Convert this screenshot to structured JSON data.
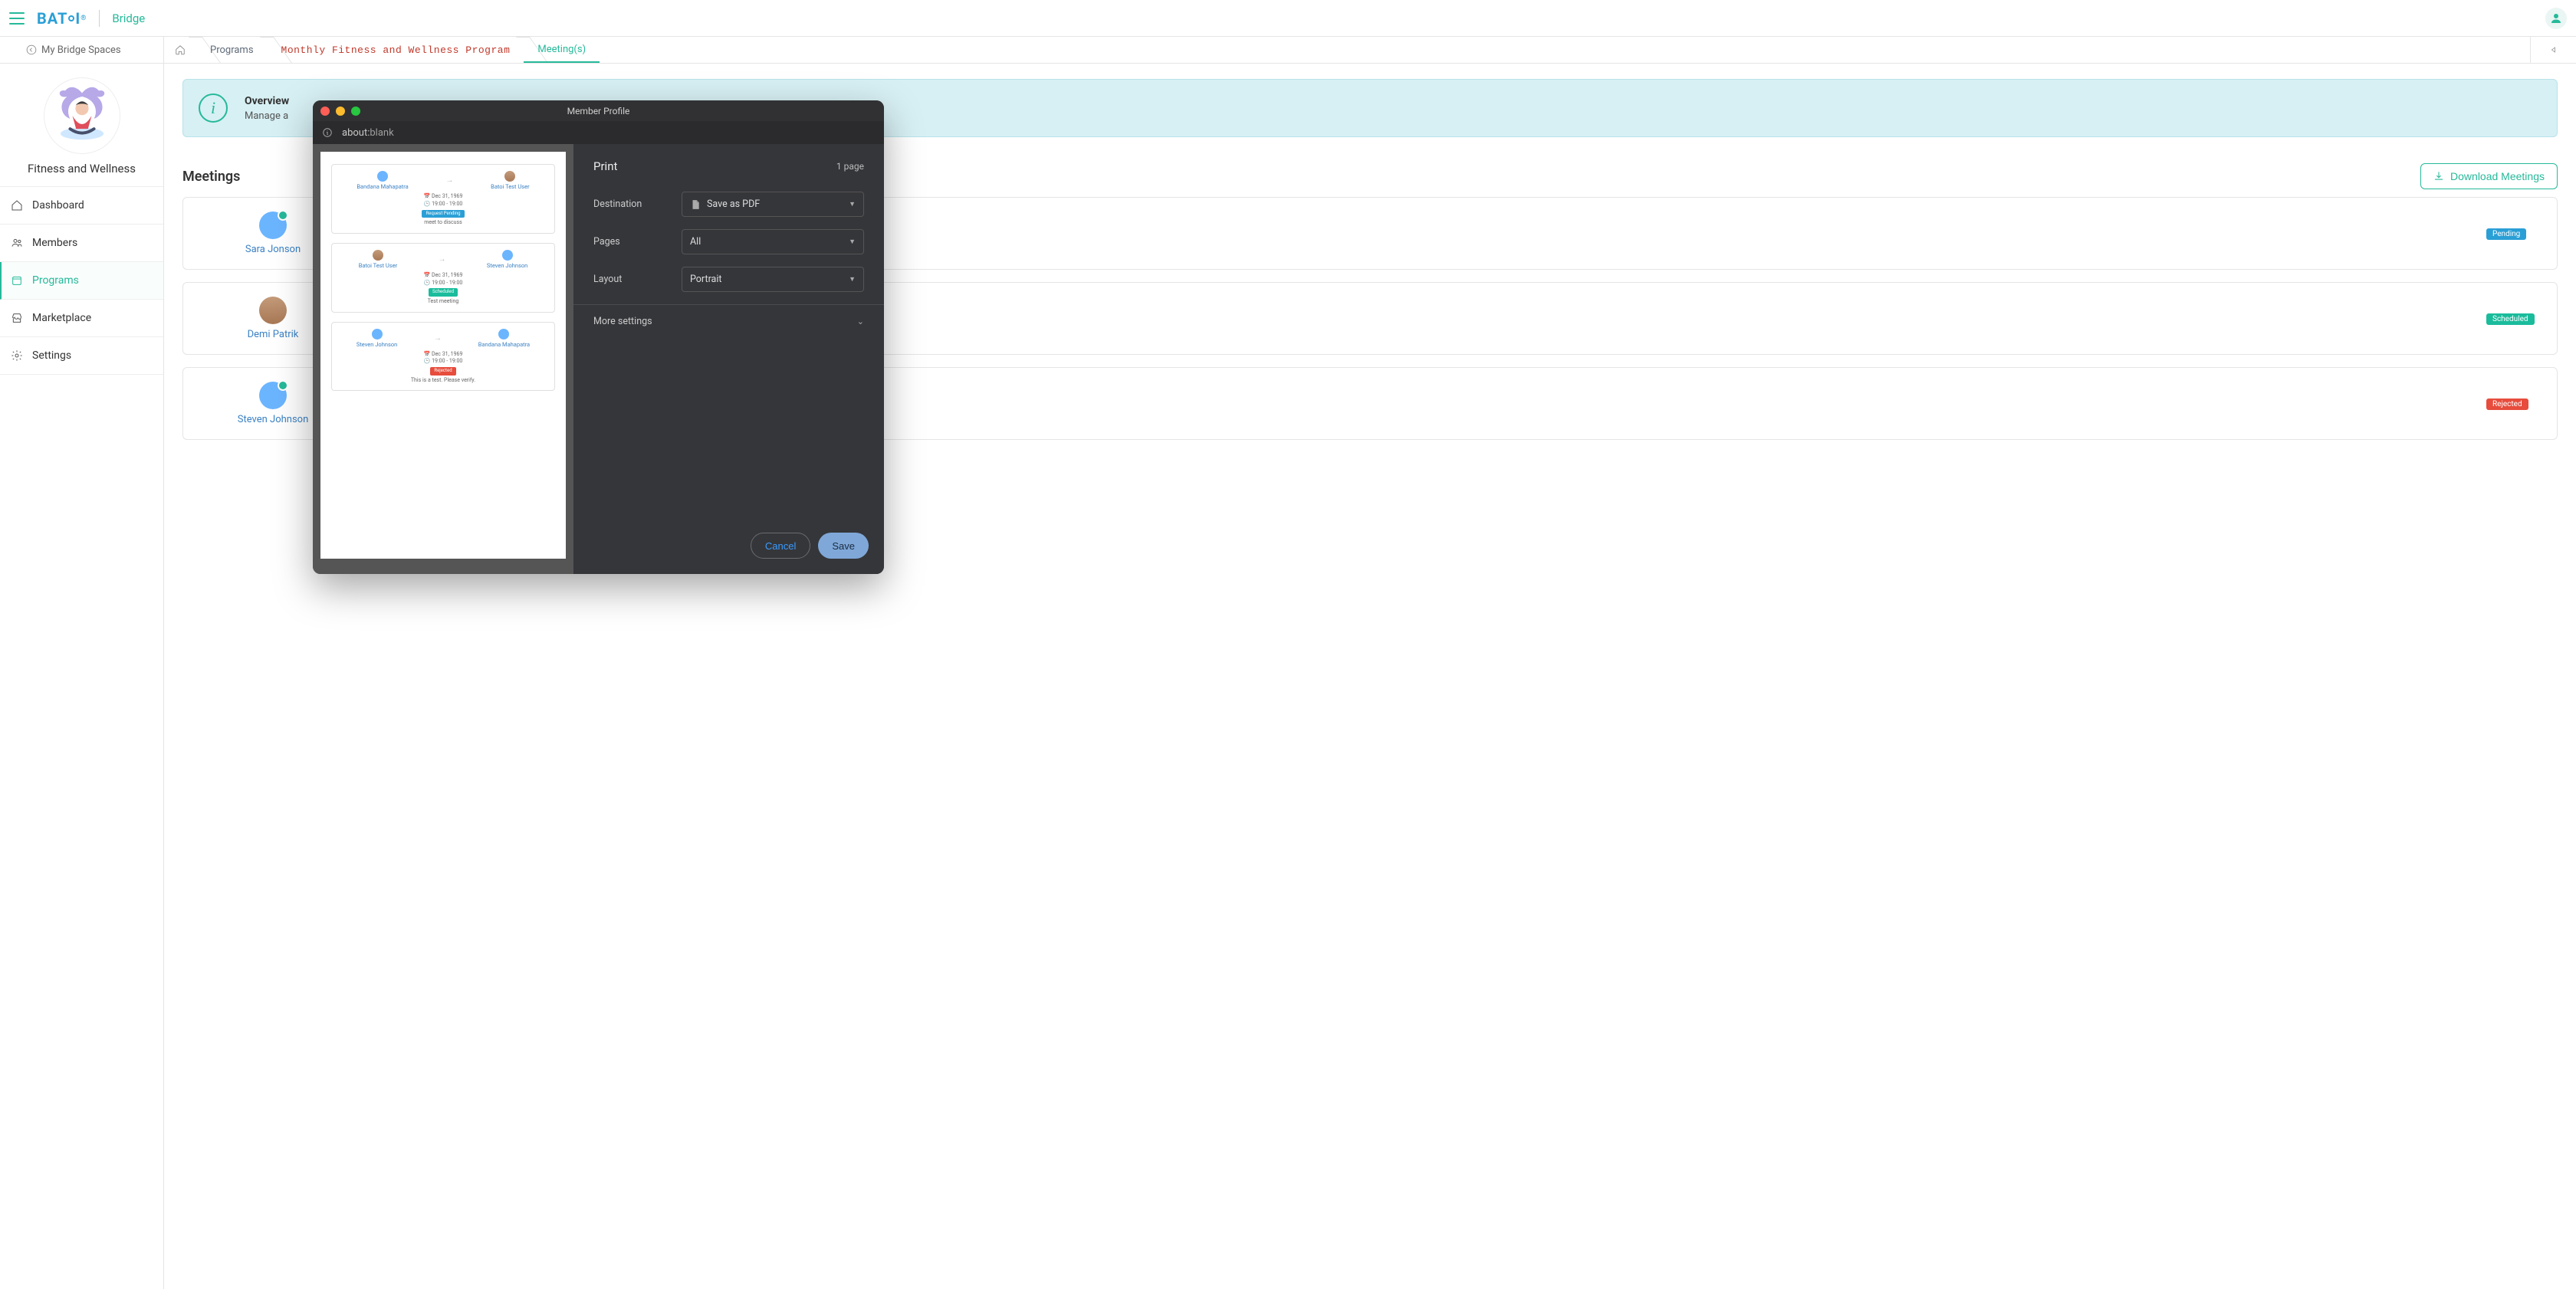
{
  "header": {
    "app_name": "Bridge",
    "logo_letters": "BATOI"
  },
  "breadcrumb": {
    "back_label": "My Bridge Spaces",
    "items": {
      "programs": "Programs",
      "program_name": "Monthly Fitness and Wellness Program",
      "meetings": "Meeting(s)"
    }
  },
  "sidebar": {
    "space_name": "Fitness and Wellness",
    "nav": [
      {
        "label": "Dashboard"
      },
      {
        "label": "Members"
      },
      {
        "label": "Programs"
      },
      {
        "label": "Marketplace"
      },
      {
        "label": "Settings"
      }
    ]
  },
  "overview": {
    "title": "Overview",
    "subtitle": "Manage a"
  },
  "page": {
    "title": "Meetings",
    "download_btn": "Download Meetings"
  },
  "meetings": [
    {
      "from": "Sara Jonson",
      "badge": "Pending",
      "badge_class": "pending"
    },
    {
      "from": "Demi Patrik",
      "badge": "Scheduled",
      "badge_class": "scheduled"
    },
    {
      "from": "Steven Johnson",
      "badge": "Rejected",
      "badge_class": "red"
    }
  ],
  "modal": {
    "title": "Member Profile",
    "url_scheme": "about:",
    "url_path": "blank",
    "print": {
      "heading": "Print",
      "page_count": "1 page",
      "destination_label": "Destination",
      "destination_value": "Save as PDF",
      "pages_label": "Pages",
      "pages_value": "All",
      "layout_label": "Layout",
      "layout_value": "Portrait",
      "more_settings": "More settings",
      "cancel": "Cancel",
      "save": "Save"
    },
    "preview": {
      "cards": [
        {
          "from": "Bandana Mahapatra",
          "to": "Batoi Test User",
          "to_photo": true,
          "date": "Dec 31, 1969",
          "time": "19:00 - 19:00",
          "badge": "Request Pending",
          "badge_class": "pending",
          "note": "meet to discuss"
        },
        {
          "from": "Batoi Test User",
          "from_photo": true,
          "to": "Steven Johnson",
          "date": "Dec 31, 1969",
          "time": "19:00 - 19:00",
          "badge": "Scheduled",
          "badge_class": "scheduled",
          "note": "Test meeting"
        },
        {
          "from": "Steven Johnson",
          "to": "Bandana Mahapatra",
          "date": "Dec 31, 1969",
          "time": "19:00 - 19:00",
          "badge": "Rejected",
          "badge_class": "red",
          "note": "This is a test. Please verify."
        }
      ]
    }
  }
}
